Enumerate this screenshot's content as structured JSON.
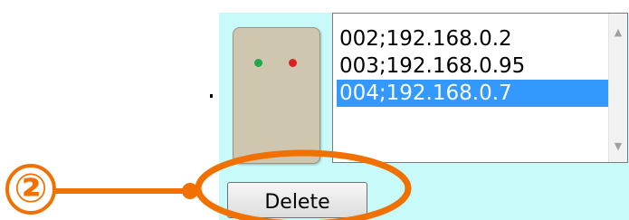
{
  "device": {
    "led_colors": {
      "left": "#1fa845",
      "right": "#e02020"
    }
  },
  "list": {
    "items": [
      {
        "label": "002;192.168.0.2",
        "selected": false
      },
      {
        "label": "003;192.168.0.95",
        "selected": false
      },
      {
        "label": "004;192.168.0.7",
        "selected": true
      }
    ],
    "scrollbar": {
      "up_icon": "chevron-up-icon",
      "down_icon": "chevron-down-icon"
    }
  },
  "delete_button": {
    "label": "Delete"
  },
  "annotation": {
    "number": "②",
    "color": "#f07000"
  }
}
